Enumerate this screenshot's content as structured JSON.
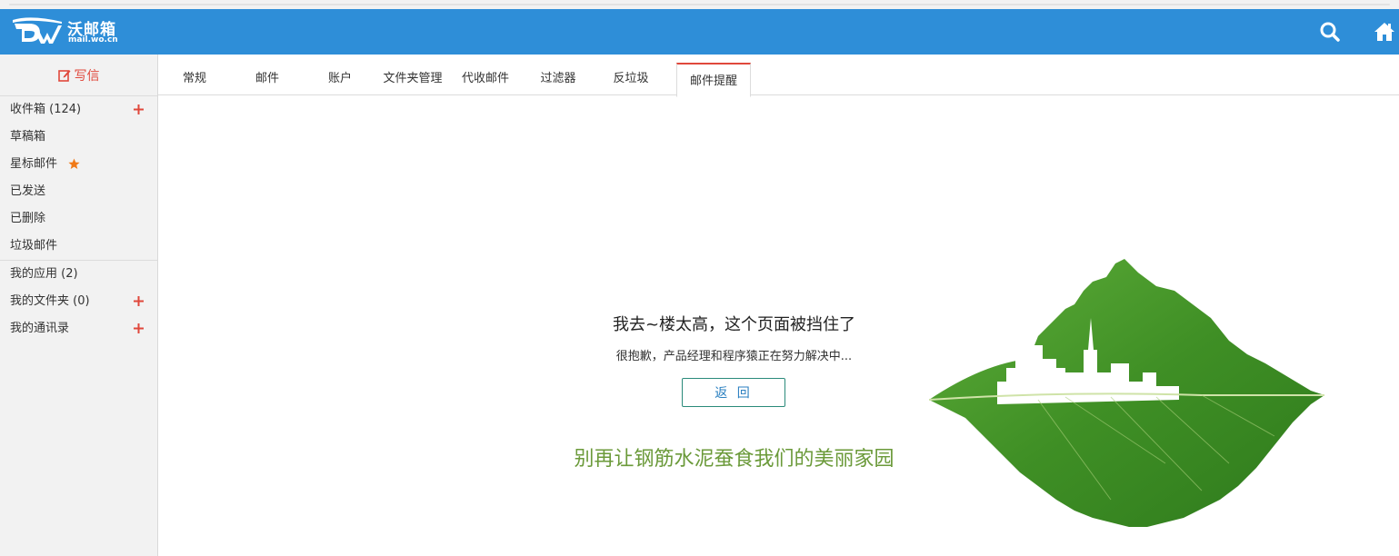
{
  "header": {
    "logo_text": "沃邮箱",
    "logo_sub": "mail.wo.cn",
    "brand_color": "#2e8ed8"
  },
  "sidebar": {
    "compose_label": "写信",
    "items": [
      {
        "label": "收件箱 (124)",
        "plus": true
      },
      {
        "label": "草稿箱"
      },
      {
        "label": "星标邮件",
        "star": true
      },
      {
        "label": "已发送"
      },
      {
        "label": "已删除"
      },
      {
        "label": "垃圾邮件"
      }
    ],
    "items2": [
      {
        "label": "我的应用 (2)"
      },
      {
        "label": "我的文件夹 (0)",
        "plus": true
      },
      {
        "label": "我的通讯录",
        "plus": true
      }
    ]
  },
  "tabs": [
    "常规",
    "邮件",
    "账户",
    "文件夹管理",
    "代收邮件",
    "过滤器",
    "反垃圾",
    "邮件提醒"
  ],
  "active_tab": "邮件提醒",
  "error_page": {
    "title": "我去~楼太高，这个页面被挡住了",
    "subtitle": "很抱歉，产品经理和程序猿正在努力解决中...",
    "back_button": "返 回",
    "slogan": "别再让钢筋水泥蚕食我们的美丽家园"
  }
}
